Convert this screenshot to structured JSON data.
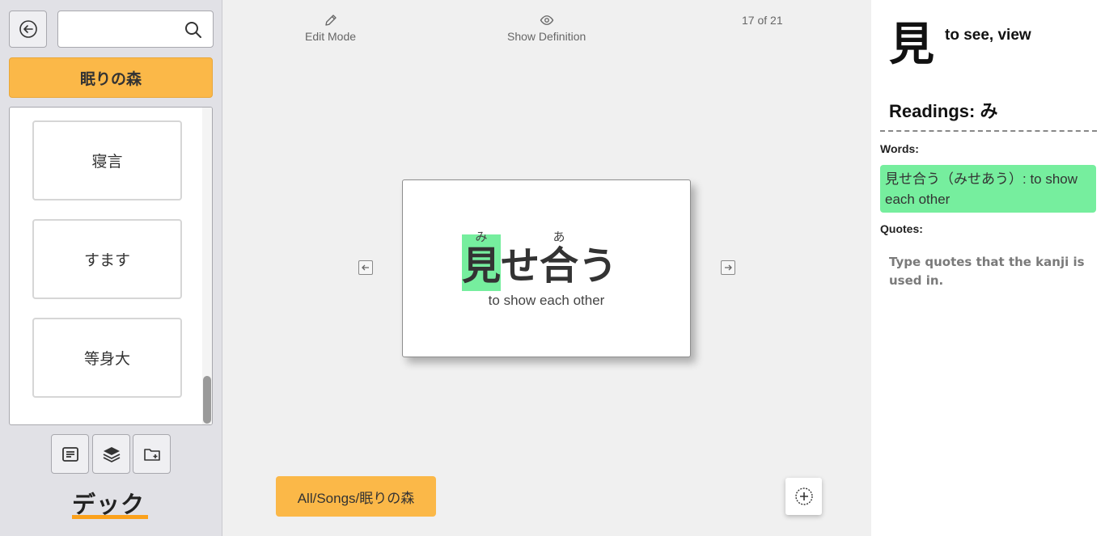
{
  "sidebar": {
    "search": {
      "value": "",
      "placeholder": ""
    },
    "deck_title": "眠りの森",
    "cards": [
      {
        "label": "寝言"
      },
      {
        "label": "すます"
      },
      {
        "label": "等身大"
      }
    ],
    "deck_label": "デック"
  },
  "toolbar": {
    "edit_mode": "Edit Mode",
    "show_definition": "Show Definition",
    "counter": "17 of 21"
  },
  "flashcard": {
    "characters": [
      {
        "char": "見",
        "furigana": "み",
        "highlighted": true
      },
      {
        "char": "せ",
        "furigana": "",
        "highlighted": false
      },
      {
        "char": "合",
        "furigana": "あ",
        "highlighted": false
      },
      {
        "char": "う",
        "furigana": "",
        "highlighted": false
      }
    ],
    "definition": "to show each other"
  },
  "path_button": "All/Songs/眠りの森",
  "kanji_panel": {
    "kanji": "見",
    "meaning": "to see, view",
    "readings": "Readings: み",
    "words_label": "Words:",
    "word_entry": "見せ合う（みせあう）: to show each other",
    "quotes_label": "Quotes:",
    "quotes_placeholder": "Type quotes that the kanji is used in."
  },
  "colors": {
    "accent_orange": "#fbb848",
    "highlight_green": "#76ee9e",
    "deck_underline": "#fba11b"
  }
}
